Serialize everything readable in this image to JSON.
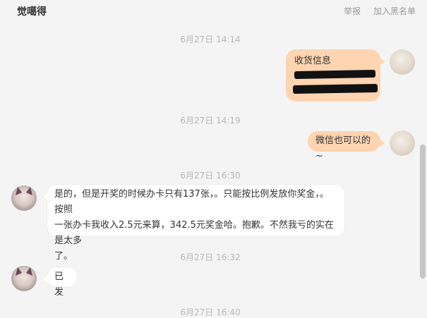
{
  "header": {
    "title": "觉噶得",
    "report_label": "举报",
    "blacklist_label": "加入黑名单"
  },
  "messages": [
    {
      "timestamp": "6月27日 14:14",
      "sender": "me",
      "text": "收货信息"
    },
    {
      "timestamp": "6月27日 14:19",
      "sender": "me",
      "text": "微信也可以的~"
    },
    {
      "timestamp": "6月27日 16:30",
      "sender": "other",
      "lines": [
        "是的，但是开奖的时候办卡只有137张，。只能按比例发放你奖金，。按照",
        "一张办卡我收入2.5元来算，342.5元奖金哈。抱歉。不然我亏的实在是太多",
        "了。"
      ]
    },
    {
      "timestamp": "6月27日 16:32",
      "sender": "other",
      "text": "已发"
    },
    {
      "timestamp": "6月27日 16:40"
    }
  ],
  "colors": {
    "my_bubble": "#ffd4b1",
    "other_bubble": "#ffffff",
    "timestamp": "#b8b8b8",
    "background": "#f4f4f4"
  }
}
